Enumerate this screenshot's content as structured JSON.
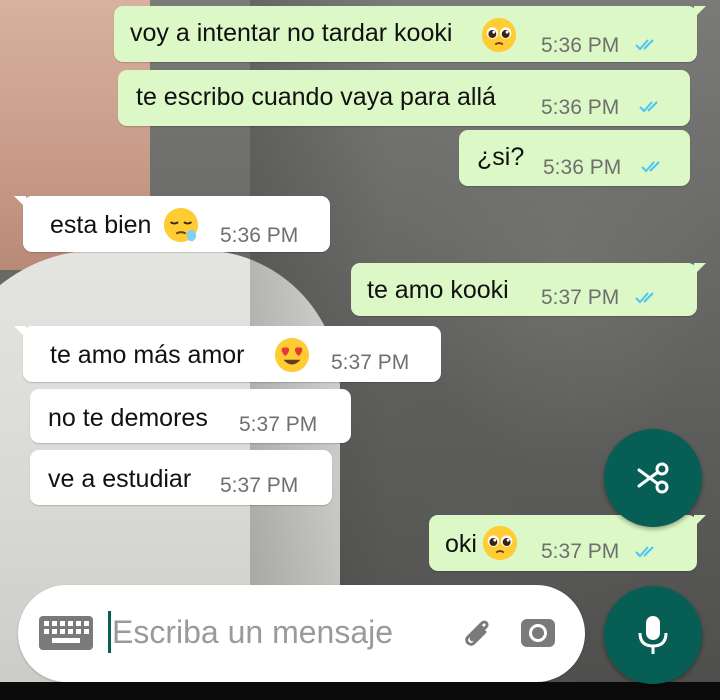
{
  "conversation": {
    "messages": [
      {
        "direction": "out",
        "text": "voy a intentar no tardar kooki",
        "emoji": "pleading-face",
        "time": "5:36 PM",
        "status": "read"
      },
      {
        "direction": "out",
        "text": "te escribo cuando vaya para allá",
        "time": "5:36 PM",
        "status": "read"
      },
      {
        "direction": "out",
        "text": "¿si?",
        "time": "5:36 PM",
        "status": "read"
      },
      {
        "direction": "in",
        "text": "esta bien",
        "emoji": "sleepy-face",
        "time": "5:36 PM"
      },
      {
        "direction": "out",
        "text": "te amo kooki",
        "time": "5:37 PM",
        "status": "read"
      },
      {
        "direction": "in",
        "text": "te amo más amor",
        "emoji": "heart-eyes-face",
        "time": "5:37 PM"
      },
      {
        "direction": "in",
        "text": "no te demores",
        "time": "5:37 PM"
      },
      {
        "direction": "in",
        "text": "ve a estudiar",
        "time": "5:37 PM"
      },
      {
        "direction": "out",
        "text": "oki",
        "emoji": "pleading-face",
        "time": "5:37 PM",
        "status": "read"
      }
    ]
  },
  "composer": {
    "placeholder": "Escriba un mensaje",
    "keyboard_icon": "keyboard-icon",
    "attach_icon": "paperclip-icon",
    "camera_icon": "camera-icon",
    "mic_icon": "microphone-icon"
  },
  "floating_action": {
    "icon": "scissors-icon"
  },
  "colors": {
    "outgoing_bubble": "#dcf8c6",
    "incoming_bubble": "#ffffff",
    "accent": "#075e54",
    "read_tick": "#4fc3f7"
  }
}
